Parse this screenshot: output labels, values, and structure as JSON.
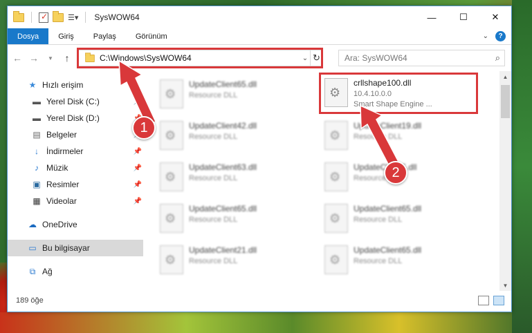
{
  "window": {
    "title": "SysWOW64"
  },
  "ribbon": {
    "tabs": [
      "Dosya",
      "Giriş",
      "Paylaş",
      "Görünüm"
    ]
  },
  "nav": {
    "address": "C:\\Windows\\SysWOW64",
    "search_placeholder": "Ara: SysWOW64"
  },
  "sidebar": {
    "items": [
      {
        "label": "Hızlı erişim",
        "icon": "star-icon"
      },
      {
        "label": "Yerel Disk (C:)",
        "icon": "drive-icon"
      },
      {
        "label": "Yerel Disk (D:)",
        "icon": "drive-icon"
      },
      {
        "label": "Belgeler",
        "icon": "documents-icon"
      },
      {
        "label": "İndirmeler",
        "icon": "download-icon"
      },
      {
        "label": "Müzik",
        "icon": "music-icon"
      },
      {
        "label": "Resimler",
        "icon": "pictures-icon"
      },
      {
        "label": "Videolar",
        "icon": "video-icon"
      },
      {
        "label": "OneDrive",
        "icon": "cloud-icon"
      },
      {
        "label": "Bu bilgisayar",
        "icon": "computer-icon"
      },
      {
        "label": "Ağ",
        "icon": "network-icon"
      }
    ]
  },
  "files": {
    "left": [
      {
        "name": "UpdateClient65.dll",
        "type": "Resource DLL"
      },
      {
        "name": "UpdateClient42.dll",
        "type": "Resource DLL"
      },
      {
        "name": "UpdateClient63.dll",
        "type": "Resource DLL"
      },
      {
        "name": "UpdateClient65.dll",
        "type": "Resource DLL"
      },
      {
        "name": "UpdateClient21.dll",
        "type": "Resource DLL"
      }
    ],
    "highlighted": {
      "name": "crllshape100.dll",
      "version": "10.4.10.0.0",
      "desc": "Smart Shape Engine ..."
    },
    "right": [
      {
        "name": "UpdateClient19.dll",
        "type": "Resource DLL"
      },
      {
        "name": "UpdateClient5.dll",
        "type": "Resource DLL"
      },
      {
        "name": "UpdateClient65.dll",
        "type": "Resource DLL"
      },
      {
        "name": "UpdateClient65.dll",
        "type": "Resource DLL"
      }
    ]
  },
  "status": {
    "count": "189 öğe"
  },
  "callouts": {
    "one": "1",
    "two": "2"
  },
  "colors": {
    "accent": "#1979ca",
    "highlight": "#d9383a"
  }
}
